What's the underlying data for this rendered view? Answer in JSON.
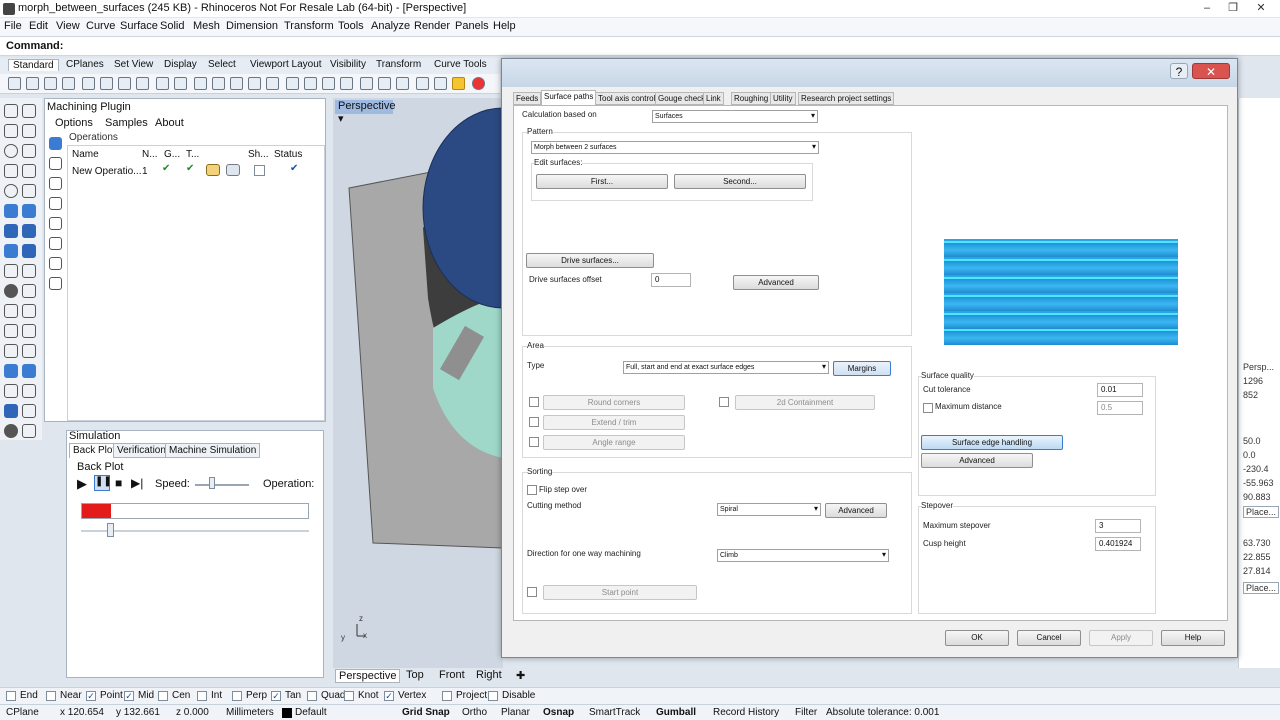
{
  "window": {
    "title": "morph_between_surfaces (245 KB) - Rhinoceros Not For Resale Lab (64-bit) - [Perspective]"
  },
  "menubar": [
    "File",
    "Edit",
    "View",
    "Curve",
    "Surface",
    "Solid",
    "Mesh",
    "Dimension",
    "Transform",
    "Tools",
    "Analyze",
    "Render",
    "Panels",
    "Help"
  ],
  "command": {
    "label": "Command:"
  },
  "toolbar_tabs": [
    "Standard",
    "CPlanes",
    "Set View",
    "Display",
    "Select",
    "Viewport Layout",
    "Visibility",
    "Transform",
    "Curve Tools"
  ],
  "plugin": {
    "title": "Machining Plugin",
    "menu": [
      "Options",
      "Samples",
      "About"
    ],
    "operations_label": "Operations",
    "columns": [
      "Name",
      "N...",
      "G...",
      "T...",
      "Sh...",
      "Status"
    ],
    "row": {
      "name": "New Operatio...",
      "n": "1"
    }
  },
  "simulation": {
    "title": "Simulation",
    "tabs": [
      "Back Plot",
      "Verification",
      "Machine Simulation"
    ],
    "section": "Back Plot",
    "speed_label": "Speed:",
    "operation_label": "Operation:",
    "progress": 0.13
  },
  "viewport": {
    "label": "Perspective",
    "tabs": [
      "Perspective",
      "Top",
      "Front",
      "Right"
    ]
  },
  "right_panel": [
    "Persp...",
    "1296",
    "852",
    "50.0",
    "0.0",
    "-230.4",
    "-55.963",
    "90.883",
    "Place...",
    "63.730",
    "22.855",
    "27.814",
    "Place..."
  ],
  "osnap": [
    {
      "label": "End",
      "checked": false
    },
    {
      "label": "Near",
      "checked": false
    },
    {
      "label": "Point",
      "checked": true
    },
    {
      "label": "Mid",
      "checked": true
    },
    {
      "label": "Cen",
      "checked": false
    },
    {
      "label": "Int",
      "checked": false
    },
    {
      "label": "Perp",
      "checked": false
    },
    {
      "label": "Tan",
      "checked": true
    },
    {
      "label": "Quad",
      "checked": false
    },
    {
      "label": "Knot",
      "checked": false
    },
    {
      "label": "Vertex",
      "checked": true
    },
    {
      "label": "Project",
      "checked": false
    },
    {
      "label": "Disable",
      "checked": false
    }
  ],
  "status": {
    "cplane": "CPlane",
    "x": "x 120.654",
    "y": "y 132.661",
    "z": "z 0.000",
    "units": "Millimeters",
    "layer": "Default",
    "grid_snap": "Grid Snap",
    "ortho": "Ortho",
    "planar": "Planar",
    "osnap": "Osnap",
    "smarttrack": "SmartTrack",
    "gumball": "Gumball",
    "record_history": "Record History",
    "filter": "Filter",
    "tolerance": "Absolute tolerance: 0.001"
  },
  "dialog": {
    "tabs": [
      "Feeds",
      "Surface paths",
      "Tool axis control",
      "Gouge check",
      "Link",
      "Roughing",
      "Utility",
      "Research project settings"
    ],
    "calc_label": "Calculation based on",
    "calc_value": "Surfaces",
    "pattern_label": "Pattern",
    "pattern_value": "Morph between 2 surfaces",
    "edit_surfaces_label": "Edit surfaces:",
    "first_btn": "First...",
    "second_btn": "Second...",
    "drive_surfaces_btn": "Drive surfaces...",
    "drive_offset_label": "Drive surfaces offset",
    "drive_offset_value": "0",
    "advanced": "Advanced",
    "area_label": "Area",
    "type_label": "Type",
    "type_value": "Full, start and end at exact surface edges",
    "margins_btn": "Margins",
    "round_corners": "Round corners",
    "containment": "2d Containment",
    "extend_trim": "Extend / trim",
    "angle_range": "Angle range",
    "sorting_label": "Sorting",
    "flip_step": "Flip step over",
    "cutting_method_label": "Cutting method",
    "cutting_method_value": "Spiral",
    "direction_label": "Direction for one way machining",
    "direction_value": "Climb",
    "start_point": "Start point",
    "surface_quality_label": "Surface quality",
    "cut_tolerance_label": "Cut tolerance",
    "cut_tolerance_value": "0.01",
    "max_distance_label": "Maximum distance",
    "max_distance_value": "0.5",
    "surface_edge_btn": "Surface edge handling",
    "stepover_label": "Stepover",
    "max_stepover_label": "Maximum stepover",
    "max_stepover_value": "3",
    "cusp_height_label": "Cusp height",
    "cusp_height_value": "0.401924",
    "ok": "OK",
    "cancel": "Cancel",
    "apply": "Apply",
    "help": "Help"
  }
}
